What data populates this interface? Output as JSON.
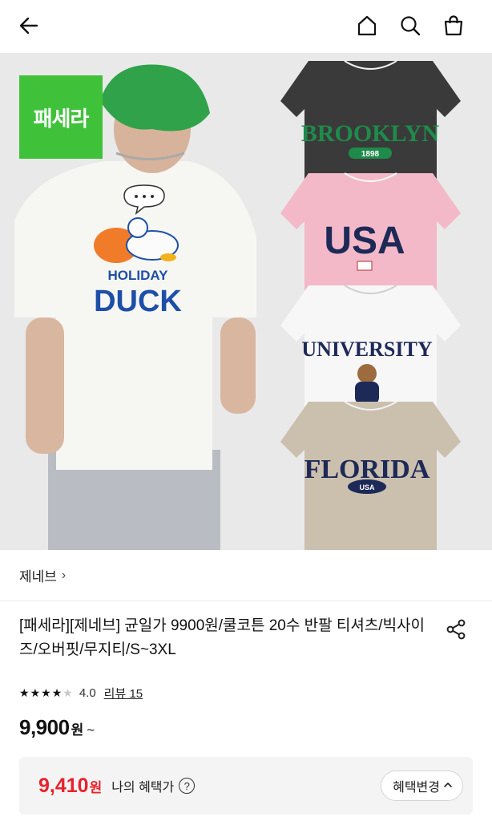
{
  "nav": {
    "back_icon": "arrow-left-icon",
    "home_icon": "home-icon",
    "search_icon": "search-icon",
    "cart_icon": "shopping-bag-icon"
  },
  "hero": {
    "badge": "패세라",
    "print_back": {
      "line1": "HOLIDAY",
      "line2": "DUCK"
    },
    "shirts": [
      {
        "text": "BROOKLYN",
        "sub": "1898",
        "color": "#3a3a3a",
        "textColor": "#1e8b4a"
      },
      {
        "text": "USA",
        "sub": "",
        "color": "#f3b9c8",
        "textColor": "#1d2a57"
      },
      {
        "text": "UNIVERSITY",
        "sub": "",
        "color": "#f7f7f7",
        "textColor": "#1d2a57"
      },
      {
        "text": "FLORIDA",
        "sub": "USA",
        "color": "#cbbfae",
        "textColor": "#1d2a57"
      }
    ]
  },
  "shop": {
    "name": "제네브",
    "chevron": "›"
  },
  "product": {
    "title": "[패세라][제네브] 균일가 9900원/쿨코튼 20수 반팔 티셔츠/빅사이즈/오버핏/무지티/S~3XL",
    "share_icon": "share-icon",
    "rating": 4.0,
    "rating_text": "4.0",
    "review_text": "리뷰 15",
    "price": "9,900",
    "price_unit": "원",
    "price_suffix": "~"
  },
  "benefit": {
    "price": "9,410",
    "unit": "원",
    "label": "나의 혜택가",
    "help": "?",
    "button": "혜택변경",
    "button_chevron": "^"
  },
  "colors": {
    "accent_red": "#e8222d",
    "badge_green": "#3fc23a"
  }
}
